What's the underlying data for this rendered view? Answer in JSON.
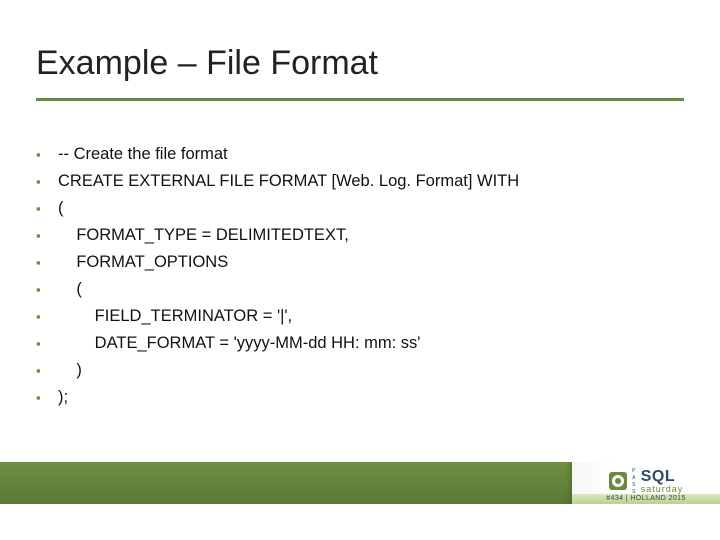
{
  "title": "Example – File Format",
  "lines": [
    "-- Create the file format",
    "CREATE EXTERNAL FILE FORMAT [Web. Log. Format] WITH",
    "(",
    "    FORMAT_TYPE = DELIMITEDTEXT,",
    "    FORMAT_OPTIONS",
    "    (",
    "        FIELD_TERMINATOR = '|',",
    "        DATE_FORMAT = 'yyyy-MM-dd HH: mm: ss'",
    "    )",
    ");"
  ],
  "footer": {
    "pass": "PASS",
    "sql": "SQL",
    "saturday": "saturday",
    "event": "#434 | HOLLAND 2015"
  }
}
